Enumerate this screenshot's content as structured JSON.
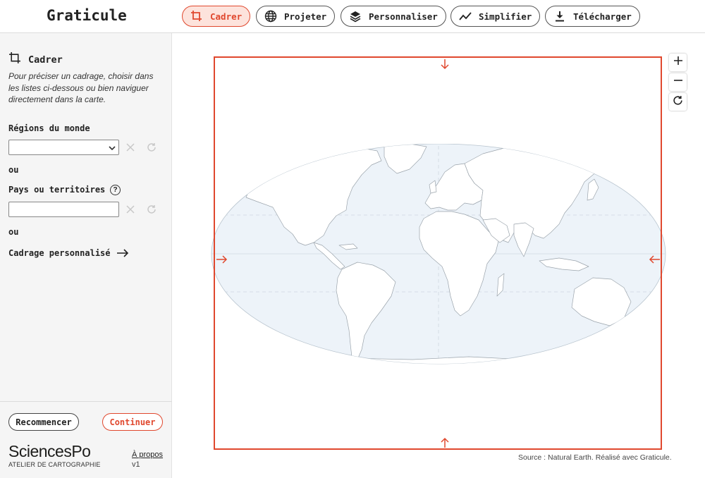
{
  "app": {
    "title": "Graticule"
  },
  "nav": [
    {
      "label": "Cadrer",
      "icon": "crop-icon",
      "active": true
    },
    {
      "label": "Projeter",
      "icon": "globe-icon",
      "active": false
    },
    {
      "label": "Personnaliser",
      "icon": "layers-icon",
      "active": false
    },
    {
      "label": "Simplifier",
      "icon": "trend-line-icon",
      "active": false
    },
    {
      "label": "Télécharger",
      "icon": "download-icon",
      "active": false
    }
  ],
  "sidebar": {
    "title": "Cadrer",
    "description": "Pour préciser un cadrage, choisir dans les listes ci-dessous ou bien naviguer directement dans la carte.",
    "regions_label": "Régions du monde",
    "regions_value": "",
    "or1": "ou",
    "countries_label": "Pays ou territoires",
    "countries_value": "",
    "or2": "ou",
    "custom_label": "Cadrage personnalisé"
  },
  "footer": {
    "restart": "Recommencer",
    "continue": "Continuer",
    "logo_main": "SciencesPo",
    "logo_sub": "ATELIER DE CARTOGRAPHIE",
    "about": "À propos",
    "version": "v1"
  },
  "map": {
    "source": "Source : Natural Earth. Réalisé avec Graticule.",
    "accent_color": "#e0482e",
    "ocean_color": "#edf3f9"
  }
}
